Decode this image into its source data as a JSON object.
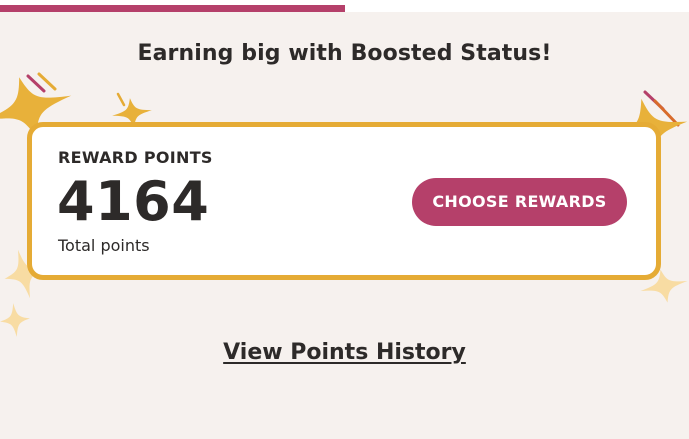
{
  "progress": {
    "fill_fraction": 0.5
  },
  "header": {
    "headline": "Earning big with Boosted Status!"
  },
  "reward_card": {
    "title": "REWARD POINTS",
    "points": "4164",
    "points_label": "Total points",
    "choose_rewards_label": "CHOOSE REWARDS"
  },
  "history": {
    "link_label": "View Points History"
  },
  "colors": {
    "brand_primary": "#b5406a",
    "card_border": "#e5ab35",
    "star_gold": "#e8b13a",
    "star_light": "#f8dca3",
    "page_background": "#f6f1ee",
    "text_dark": "#2d2a29"
  }
}
